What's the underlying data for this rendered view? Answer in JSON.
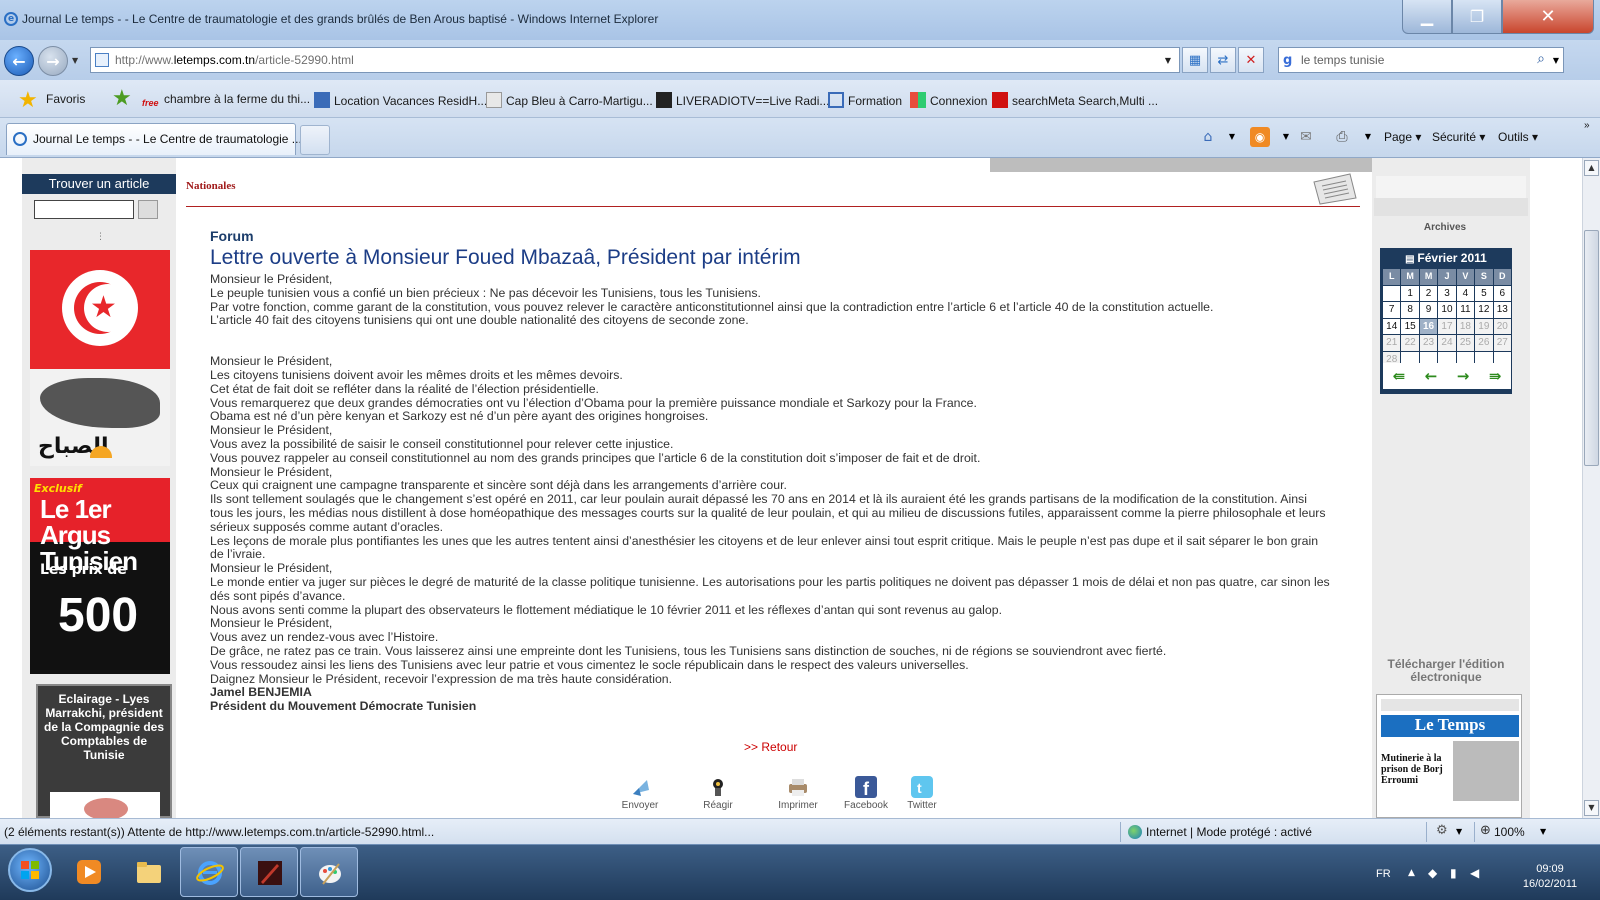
{
  "window": {
    "title": "Journal Le temps - - Le Centre de traumatologie et des grands brûlés de Ben Arous baptisé - Windows Internet Explorer",
    "minimize": "▁",
    "maximize": "❐",
    "close": "✕"
  },
  "address_bar": {
    "url_prefix": "http://www.",
    "url_domain": "letemps.com.tn",
    "url_path": "/article-52990.html"
  },
  "search_box": {
    "value": "le temps tunisie",
    "provider_glyph": "g"
  },
  "favorites_bar": {
    "label": "Favoris",
    "items": [
      {
        "label": "chambre à la ferme du thi...",
        "icon": "free-icon",
        "icon_glyph": "free"
      },
      {
        "label": "Location Vacances ResidH...",
        "icon": "page-icon"
      },
      {
        "label": "Cap Bleu à Carro-Martigu...",
        "icon": "page-icon"
      },
      {
        "label": "LIVERADIOTV==Live Radi...",
        "icon": "tv-icon"
      },
      {
        "label": "Formation",
        "icon": "page-icon"
      },
      {
        "label": "Connexion",
        "icon": "windows-icon"
      },
      {
        "label": "searchMeta Search,Multi ...",
        "icon": "pc-icon"
      }
    ]
  },
  "tabs": {
    "active_label": "Journal Le temps - - Le Centre de traumatologie ...",
    "commands": {
      "page": "Page ▾",
      "security": "Sécurité ▾",
      "tools": "Outils ▾"
    }
  },
  "left_column": {
    "find_title": "Trouver un article",
    "find_value": "",
    "flag_arabic_text": "الصباح",
    "argus_ad": {
      "tag": "Exclusif",
      "headline": "Le 1er Argus Tunisien",
      "line2": "Les prix de",
      "number": "500"
    },
    "promo_title": "Eclairage - Lyes Marrakchi, président de la Compagnie des Comptables de Tunisie"
  },
  "article": {
    "section": "Nationales",
    "rubric": "Forum",
    "headline": "Lettre ouverte à Monsieur Foued Mbazaâ, Président par intérim",
    "paragraph_1": [
      "Monsieur le Président,",
      "Le peuple tunisien vous a confié un bien précieux : Ne pas décevoir les Tunisiens, tous les Tunisiens.",
      "Par votre fonction, comme garant de la constitution, vous pouvez relever le caractère anticonstitutionnel ainsi que la contradiction entre l’article 6 et l’article 40 de la constitution actuelle.",
      "L’article 40 fait des citoyens tunisiens qui ont une double nationalité des citoyens de seconde zone."
    ],
    "paragraph_2": [
      "Monsieur le Président,",
      "Les citoyens tunisiens doivent avoir les mêmes droits et les mêmes devoirs.",
      "Cet état de fait doit se refléter dans la réalité de l’élection présidentielle.",
      "Vous remarquerez que deux grandes démocraties ont vu l’élection d’Obama pour la première puissance mondiale et Sarkozy pour la France.",
      "Obama est né d’un père kenyan et Sarkozy est né d’un père ayant des origines hongroises.",
      "Monsieur le Président,",
      "Vous avez la possibilité de saisir le conseil constitutionnel pour relever cette injustice.",
      "Vous pouvez rappeler au conseil constitutionnel au nom des grands principes que l’article 6 de la constitution doit s’imposer de fait et de droit.",
      "Monsieur le Président,",
      "Ceux qui craignent une campagne transparente et sincère sont déjà dans les arrangements d’arrière cour.",
      "Ils sont tellement soulagés que le changement s’est opéré en 2011, car leur poulain aurait dépassé les 70 ans en 2014 et là ils auraient été les grands partisans de la modification de la constitution. Ainsi tous les jours, les médias nous distillent à dose homéopathique des messages courts sur la qualité de leur poulain, et qui au milieu de discussions futiles, apparaissent comme la pierre philosophale et leurs sérieux supposés comme autant d’oracles.",
      "Les leçons de morale plus pontifiantes les unes que les autres tentent ainsi d’anesthésier les citoyens et de leur enlever ainsi tout esprit critique. Mais le peuple n’est pas dupe et il sait séparer le bon grain de l’ivraie.",
      "Monsieur le Président,",
      "Le monde entier va juger sur pièces le degré de maturité de la classe politique tunisienne. Les autorisations pour les partis politiques ne doivent pas dépasser 1 mois de délai et non pas quatre, car sinon les dés sont pipés d’avance.",
      "Nous avons senti comme la plupart des observateurs le flottement médiatique le 10 février 2011 et les réflexes d’antan qui sont revenus au galop.",
      "Monsieur le Président,",
      "Vous avez un rendez-vous avec l’Histoire.",
      "De grâce, ne ratez pas ce train. Vous laisserez ainsi une empreinte dont les Tunisiens, tous les Tunisiens sans distinction de souches, ni de régions se souviendront avec fierté.",
      "Vous ressoudez ainsi les liens des Tunisiens avec leur patrie et vous cimentez le socle républicain dans le respect des valeurs universelles.",
      "Daignez Monsieur le Président, recevoir l’expression de ma très haute considération."
    ],
    "signature_name": "Jamel BENJEMIA",
    "signature_title": "Président du Mouvement Démocrate Tunisien",
    "back_link": ">> Retour",
    "share": [
      {
        "label": "Envoyer",
        "icon": "send-icon"
      },
      {
        "label": "Réagir",
        "icon": "react-icon"
      },
      {
        "label": "Imprimer",
        "icon": "print-icon"
      },
      {
        "label": "Facebook",
        "icon": "facebook-icon"
      },
      {
        "label": "Twitter",
        "icon": "twitter-icon"
      }
    ]
  },
  "right_column": {
    "archives_label": "Archives",
    "calendar": {
      "month": "Février 2011",
      "day_headers": [
        "L",
        "M",
        "M",
        "J",
        "V",
        "S",
        "D"
      ],
      "rows": [
        [
          "",
          "1",
          "2",
          "3",
          "4",
          "5",
          "6"
        ],
        [
          "7",
          "8",
          "9",
          "10",
          "11",
          "12",
          "13"
        ],
        [
          "14",
          "15",
          "16",
          "17",
          "18",
          "19",
          "20"
        ],
        [
          "21",
          "22",
          "23",
          "24",
          "25",
          "26",
          "27"
        ],
        [
          "28",
          "",
          "",
          "",
          "",
          "",
          ""
        ]
      ],
      "today": "16",
      "nav": [
        "⇚",
        "←",
        "→",
        "⇛"
      ]
    },
    "download_label": "Télécharger l'édition électronique",
    "epaper": {
      "masthead": "Le Temps",
      "headline": "Mutinerie à la prison de Borj Erroumi"
    }
  },
  "status_bar": {
    "status": "(2 éléments restant(s)) Attente de http://www.letemps.com.tn/article-52990.html...",
    "zone": "Internet | Mode protégé : activé",
    "zoom": "100%"
  },
  "taskbar": {
    "language": "FR",
    "time": "09:09",
    "date": "16/02/2011"
  }
}
